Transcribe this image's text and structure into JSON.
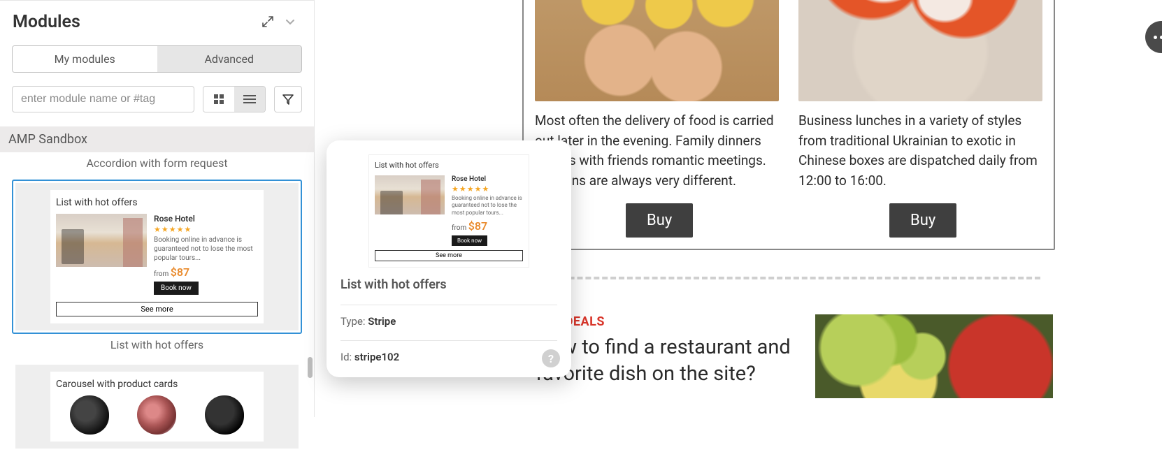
{
  "sidebar": {
    "title": "Modules",
    "tabs": {
      "my": "My modules",
      "advanced": "Advanced"
    },
    "search_placeholder": "enter module name or #tag",
    "category": "AMP Sandbox",
    "caption_accordion": "Accordion with form request",
    "caption_hot": "List with hot offers",
    "hot": {
      "heading": "List with hot offers",
      "hotel": "Rose Hotel",
      "stars": "★★★★★",
      "blurb": "Booking online in advance is guaranteed not to lose the most popular tours...",
      "from": "from ",
      "price": "$87",
      "book": "Book now",
      "see": "See more"
    },
    "carousel_heading": "Carousel with product cards"
  },
  "tooltip": {
    "title": "List with hot offers",
    "type_label": "Type: ",
    "type_value": "Stripe",
    "id_label": "Id: ",
    "id_value": "stripe102"
  },
  "preview": {
    "card1_text": "Most often the delivery of food is carried out later in the evening. Family dinners parties with friends romantic meetings. Reasons are always very different.",
    "card2_text": "Business lunches in a variety of styles from traditional Ukrainian to exotic in Chinese boxes are dispatched daily from 12:00 to 16:00.",
    "buy": "Buy",
    "promo_label": "HOT DEALS",
    "promo_heading": "How to find a restaurant and favorite dish on the site?"
  }
}
